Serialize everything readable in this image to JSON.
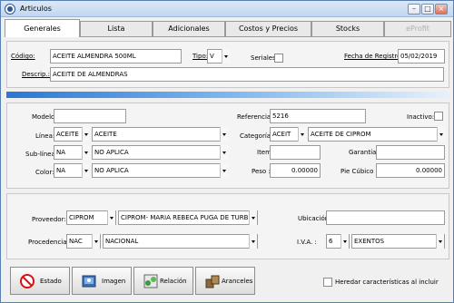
{
  "window": {
    "title": "Articulos"
  },
  "tabs": [
    {
      "label": "Generales"
    },
    {
      "label": "Lista"
    },
    {
      "label": "Adicionales"
    },
    {
      "label": "Costos y Precios"
    },
    {
      "label": "Stocks"
    },
    {
      "label": "eProfit"
    }
  ],
  "general": {
    "codigo_label": "Código:",
    "codigo_value": "ACEITE ALMENDRA 500ML",
    "tipo_label": "Tipo:",
    "tipo_value": "V",
    "seriales_label": "Seriales",
    "fecha_label": "Fecha de Registro:",
    "fecha_value": "05/02/2019",
    "descrip_label": "Descrip.:",
    "descrip_value": "ACEITE DE ALMENDRAS"
  },
  "details": {
    "modelo_label": "Modelo:",
    "modelo_value": "",
    "referencia_label": "Referencia:",
    "referencia_value": "5216",
    "inactivo_label": "Inactivo:",
    "linea_label": "Línea:",
    "linea_code": "ACEITE",
    "linea_desc": "ACEITE",
    "categoria_label": "Categoría:",
    "categoria_code": "ACEIT",
    "categoria_desc": "ACEITE DE CIPROM",
    "sublinea_label": "Sub-línea:",
    "sublinea_code": "NA",
    "sublinea_desc": "NO APLICA",
    "item_label": "Item:",
    "item_value": "",
    "garantia_label": "Garantía:",
    "garantia_value": "",
    "color_label": "Color:",
    "color_code": "NA",
    "color_desc": "NO APLICA",
    "peso_label": "Peso :",
    "peso_value": "0.00000",
    "piecubico_label": "Pie Cúbico :",
    "piecubico_value": "0.00000"
  },
  "supplier": {
    "proveedor_label": "Proveedor:",
    "proveedor_code": "CIPROM",
    "proveedor_desc": "CIPROM- MARIA REBECA PUGA DE TURBINO",
    "ubicacion_label": "Ubicación:",
    "ubicacion_value": "",
    "procedencia_label": "Procedencia:",
    "procedencia_code": "NAC",
    "procedencia_desc": "NACIONAL",
    "iva_label": "I.V.A. :",
    "iva_code": "6",
    "iva_desc": "EXENTOS"
  },
  "buttons": {
    "estado": "Estado",
    "imagen": "Imagen",
    "relacion": "Relación",
    "aranceles": "Aranceles",
    "heredar": "Heredar características al incluir"
  },
  "colors": {
    "accent": "#2a78d4"
  }
}
